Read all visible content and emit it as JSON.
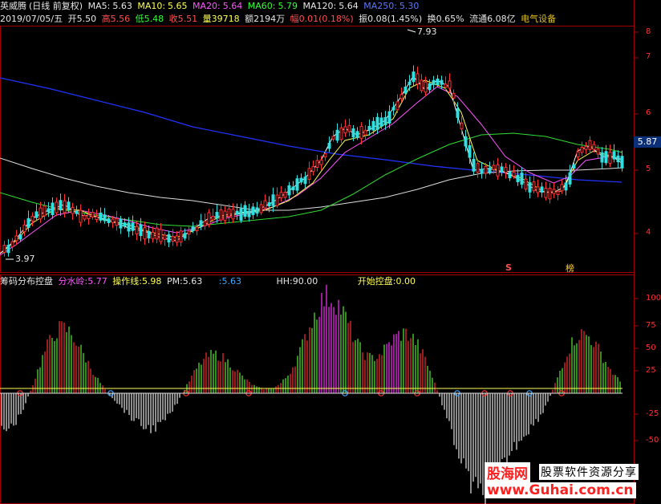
{
  "header": {
    "stock_name": "英威腾",
    "chart_mode": "(日线 前复权)",
    "ma5_label": "MA5:",
    "ma5_value": "5.63",
    "ma10_label": "MA10:",
    "ma10_value": "5.65",
    "ma20_label": "MA20:",
    "ma20_value": "5.64",
    "ma60_label": "MA60:",
    "ma60_value": "5.79",
    "ma120_label": "MA120:",
    "ma120_value": "5.64",
    "ma250_label": "MA250:",
    "ma250_value": "5.30"
  },
  "quote": {
    "date": "2019/07/05/五",
    "open_label": "开",
    "open": "5.50",
    "high_label": "高",
    "high": "5.56",
    "low_label": "低",
    "low": "5.48",
    "close_label": "收",
    "close": "5.51",
    "volume_label": "量",
    "volume": "39718",
    "amount_label": "额",
    "amount": "2194万",
    "change_label": "幅",
    "change": "0.01(0.18%)",
    "amplitude_label": "振",
    "amplitude": "0.08(1.45%)",
    "turnover_label": "换",
    "turnover": "0.65%",
    "float_label": "流通",
    "float": "6.08亿",
    "sector": "电气设备"
  },
  "price_axis": [
    "8",
    "7",
    "6",
    "5",
    "4"
  ],
  "current_price_badge": "5.87",
  "peak_marker": "7.93",
  "trough_marker": "3.97",
  "event_marks": {
    "s_mark": "S",
    "bang_mark": "榜"
  },
  "indicator": {
    "name": "筹码分布控盘",
    "fenshuiling_label": "分水岭:",
    "fenshuiling": "5.77",
    "caozuoxian_label": "操作线:",
    "caozuoxian": "5.98",
    "pm_label": "PM:",
    "pm": "5.63",
    "extra_value": ":5.63",
    "hh_label": "HH:",
    "hh": "90.00",
    "kaishi_label": "开始控盘:",
    "kaishi": "0.00"
  },
  "indicator_axis": [
    "100",
    "75",
    "50",
    "25",
    "-25",
    "-50"
  ],
  "colors": {
    "ma5": "#ffffff",
    "ma10": "#ffff55",
    "ma20": "#ff55ff",
    "ma60": "#33dd33",
    "ma120": "#dddddd",
    "ma250": "#2233ff",
    "up": "#ff3030",
    "down": "#30e0e0",
    "panel_border": "#a00000"
  },
  "watermark": {
    "cn_name": "股海网",
    "tagline": "股票软件资源分享",
    "url": "www.Guhai.com.cn"
  }
}
